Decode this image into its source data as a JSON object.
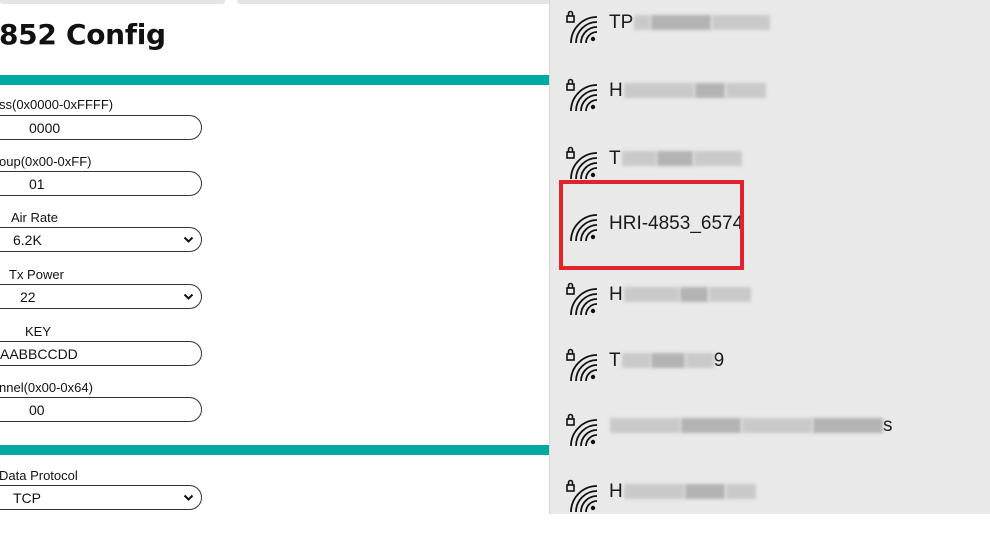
{
  "config": {
    "title": "852 Config",
    "fields": [
      {
        "label": "ss(0x0000-0xFFFF)",
        "value": "0000"
      },
      {
        "label": "oup(0x00-0xFF)",
        "value": "01"
      },
      {
        "label": "Air Rate",
        "value": "6.2K"
      },
      {
        "label": "Tx Power",
        "value": "22"
      },
      {
        "label": "KEY",
        "value": "AABBCCDD"
      },
      {
        "label": "nnel(0x00-0x64)",
        "value": "00"
      },
      {
        "label": "Data Protocol",
        "value": "TCP"
      }
    ]
  },
  "wifi": {
    "networks": [
      {
        "name_visible": "TP",
        "secured": true
      },
      {
        "name_visible": "H",
        "secured": true
      },
      {
        "name_visible": "T",
        "secured": true
      },
      {
        "name_visible": "HRI-4853_6574",
        "secured": false,
        "highlighted": true
      },
      {
        "name_visible": "H",
        "secured": true
      },
      {
        "name_visible": "T",
        "suffix": "9",
        "secured": true
      },
      {
        "name_visible": "",
        "suffix": "s",
        "secured": true
      },
      {
        "name_visible": "H",
        "secured": true
      }
    ],
    "highlight_color": "#e3232b"
  },
  "colors": {
    "accent": "#00a8a2",
    "panel": "#e9e9e9"
  }
}
